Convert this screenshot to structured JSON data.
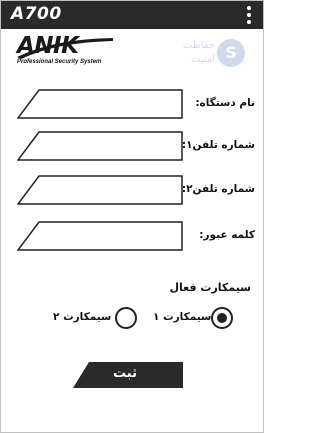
{
  "app": {
    "title": "A700"
  },
  "logo": {
    "brand": "ANIK",
    "tagline": "Professional Security System"
  },
  "watermark": {
    "text_line1": "حفاظت",
    "text_line2": "امنیت",
    "badge": "S"
  },
  "form": {
    "fields": [
      {
        "label": "نام دستگاه:",
        "value": ""
      },
      {
        "label": "شماره تلفن۱:",
        "value": ""
      },
      {
        "label": "شماره تلفن۲:",
        "value": ""
      },
      {
        "label": "کلمه عبور:",
        "value": ""
      }
    ],
    "sim": {
      "title": "سیمکارت فعال",
      "options": [
        {
          "label": "سیمکارت ۱",
          "selected": true
        },
        {
          "label": "سیمکارت ۲",
          "selected": false
        }
      ]
    },
    "submit_label": "ثبت"
  },
  "colors": {
    "topbar": "#2a2a2a",
    "button": "#2a2a2a",
    "accent_text": "#111111"
  }
}
